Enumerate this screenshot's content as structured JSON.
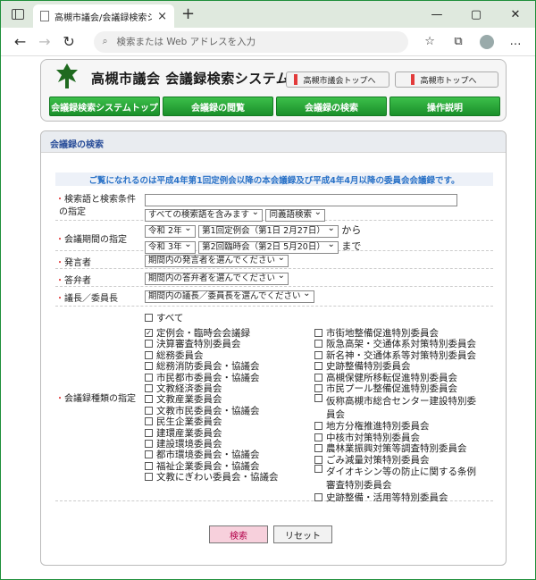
{
  "browser": {
    "tab_title": "高槻市議会/会議録検索システム",
    "address_placeholder": "検索または Web アドレスを入力"
  },
  "header": {
    "site_title": "高槻市議会  会議録検索システム",
    "top_links": [
      "高槻市議会トップへ",
      "高槻市トップへ"
    ],
    "menu": [
      "会議録検索システムトップ",
      "会議録の閲覧",
      "会議録の検索",
      "操作説明"
    ]
  },
  "panel": {
    "title": "会議録の検索",
    "notice": "ご覧になれるのは平成4年第1回定例会以降の本会議録及び平成4年4月以降の委員会会議録です。"
  },
  "form": {
    "keyword": {
      "label": "検索語と検索条件の指定",
      "value": "",
      "match_option": "すべての検索語を含みます",
      "search_type": "同義語検索"
    },
    "period": {
      "label": "会議期間の指定",
      "from_year": "令和 2年",
      "from_session": "第1回定例会（第1日 2月27日）",
      "from_suffix": "から",
      "to_year": "令和 3年",
      "to_session": "第2回臨時会（第2日 5月20日）",
      "to_suffix": "まで"
    },
    "speaker": {
      "label": "発言者",
      "option": "期間内の発言者を選んでください"
    },
    "answerer": {
      "label": "答弁者",
      "option": "期間内の答弁者を選んでください"
    },
    "chair": {
      "label": "議長／委員長",
      "option": "期間内の議長／委員長を選んでください"
    },
    "meeting_types": {
      "label": "会議録種類の指定",
      "all_label": "すべて",
      "left_column": [
        {
          "label": "定例会・臨時会会議録",
          "checked": true
        },
        {
          "label": "決算審査特別委員会",
          "checked": false
        },
        {
          "label": "総務委員会",
          "checked": false
        },
        {
          "label": "総務消防委員会・協議会",
          "checked": false
        },
        {
          "label": "市民都市委員会・協議会",
          "checked": false
        },
        {
          "label": "文教経済委員会",
          "checked": false
        },
        {
          "label": "文教産業委員会",
          "checked": false
        },
        {
          "label": "文教市民委員会・協議会",
          "checked": false
        },
        {
          "label": "民生企業委員会",
          "checked": false
        },
        {
          "label": "建環産業委員会",
          "checked": false
        },
        {
          "label": "建設環境委員会",
          "checked": false
        },
        {
          "label": "都市環境委員会・協議会",
          "checked": false
        },
        {
          "label": "福祉企業委員会・協議会",
          "checked": false
        },
        {
          "label": "文教にぎわい委員会・協議会",
          "checked": false
        }
      ],
      "right_column": [
        {
          "label": "市街地整備促進特別委員会",
          "checked": false
        },
        {
          "label": "阪急高架・交通体系対策特別委員会",
          "checked": false
        },
        {
          "label": "新名神・交通体系等対策特別委員会",
          "checked": false
        },
        {
          "label": "史跡整備特別委員会",
          "checked": false
        },
        {
          "label": "高槻保健所移転促進特別委員会",
          "checked": false
        },
        {
          "label": "市民プール整備促進特別委員会",
          "checked": false
        },
        {
          "label": "仮称高槻市総合センター建設特別委員会",
          "checked": false
        },
        {
          "label": "地方分権推進特別委員会",
          "checked": false
        },
        {
          "label": "中核市対策特別委員会",
          "checked": false
        },
        {
          "label": "農林業振興対策等調査特別委員会",
          "checked": false
        },
        {
          "label": "ごみ減量対策特別委員会",
          "checked": false
        },
        {
          "label": "ダイオキシン等の防止に関する条例審査特別委員会",
          "checked": false
        },
        {
          "label": "史跡整備・活用等特別委員会",
          "checked": false
        }
      ]
    }
  },
  "buttons": {
    "search": "検索",
    "reset": "リセット"
  },
  "colors": {
    "menu_green": "#1a8f2a",
    "heading_blue": "#2b4f9a",
    "notice_blue": "#2a72c7",
    "search_pink": "#f7d0dc"
  }
}
